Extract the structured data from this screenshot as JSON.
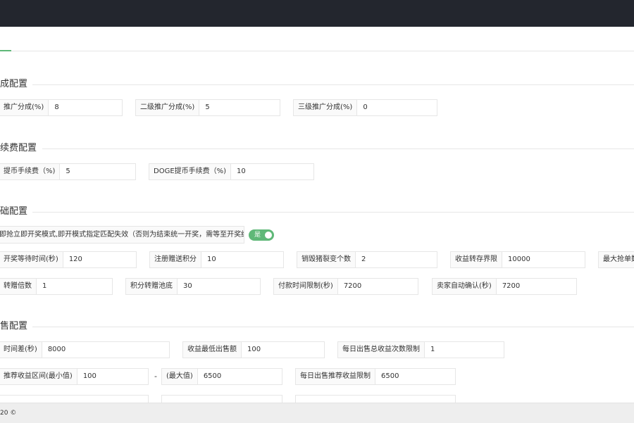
{
  "sections": {
    "commission": "成配置",
    "fee": "续费配置",
    "basic": "础配置",
    "sell": "售配置"
  },
  "commission": {
    "level1_label": "推广分成(%)",
    "level1_value": "8",
    "level2_label": "二级推广分成(%)",
    "level2_value": "5",
    "level3_label": "三级推广分成(%)",
    "level3_value": "0"
  },
  "fee": {
    "coin_label": "提币手续费（%)",
    "coin_value": "5",
    "doge_label": "DOGE提币手续费（%)",
    "doge_value": "10"
  },
  "basic": {
    "mode_label": "即抢立即开奖模式,即开模式指定匹配失效（否则为结束统一开奖，需等至开奖结束）",
    "mode_switch_text": "是",
    "wait_label": "开奖等待时间(秒)",
    "wait_value": "120",
    "register_label": "注册赠送积分",
    "register_value": "10",
    "burn_label": "销毁猪裂变个数",
    "burn_value": "2",
    "transfer_limit_label": "收益转存界限",
    "transfer_limit_value": "10000",
    "max_grab_label": "最大抢单数",
    "multiple_label": "转赠倍数",
    "multiple_value": "1",
    "pool_label": "积分转赠池底",
    "pool_value": "30",
    "pay_limit_label": "付款时间限制(秒)",
    "pay_limit_value": "7200",
    "confirm_label": "卖家自动确认(秒)",
    "confirm_value": "7200"
  },
  "sell": {
    "time_diff_label": "时间差(秒)",
    "time_diff_value": "8000",
    "min_sell_label": "收益最低出售额",
    "min_sell_value": "100",
    "daily_count_label": "每日出售总收益次数限制",
    "daily_count_value": "1",
    "range_min_label": "推荐收益区间(最小值)",
    "range_min_value": "100",
    "range_dash": "-",
    "range_max_label": "(最大值)",
    "range_max_value": "6500",
    "daily_recommend_label": "每日出售推荐收益限制",
    "daily_recommend_value": "6500"
  },
  "footer": {
    "text": "20 ©"
  },
  "colors": {
    "topbar": "#23262e",
    "accent": "#5FB878"
  }
}
